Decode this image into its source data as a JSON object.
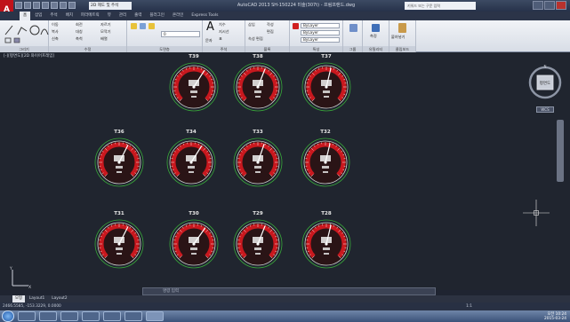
{
  "app": {
    "window_title": "AutoCAD 2013    SH-150224 미술(307t) - 프림프랜드.dwg",
    "workspace": "2D 제도 및 주석",
    "search_placeholder": "키워드 또는 구문 입력",
    "logo": "A"
  },
  "ribbon": {
    "tabs": [
      "홈",
      "삽입",
      "주석",
      "배치",
      "파라메트릭",
      "뷰",
      "관리",
      "출력",
      "플러그인",
      "온라인",
      "Express Tools"
    ],
    "active_tab": 0,
    "groups": {
      "draw": "그리기",
      "modify": "수정",
      "layers": "도면층",
      "annotation": "주석",
      "block": "블록",
      "properties": "특성",
      "groups": "그룹",
      "utilities": "유틸리티",
      "clipboard": "클립보드"
    },
    "draw_tools": [
      "선",
      "폴리선",
      "원",
      "호"
    ],
    "modify_tools": [
      "이동",
      "회전",
      "자르기",
      "복사",
      "대칭",
      "모깍기",
      "신축",
      "축척",
      "배열"
    ],
    "annotation_tools": [
      "문자",
      "치수",
      "지시선",
      "표"
    ],
    "block_tools": [
      "삽입",
      "작성",
      "편집",
      "속성 편집"
    ],
    "properties_values": [
      "ByLayer",
      "ByLayer",
      "ByLayer"
    ],
    "layer_value": "0",
    "group_label": "그룹",
    "paste_label": "붙여넣기",
    "measure_label": "측정",
    "text_label": "문자",
    "dimension_label": "치수",
    "insert_label": "삽입",
    "match_label": "특성 일치"
  },
  "viewport_label": "[-][평면도][2D 와이어프레임]",
  "gauges": [
    {
      "label": "T39",
      "needle": 0.62
    },
    {
      "label": "T38",
      "needle": 0.58
    },
    {
      "label": "T37",
      "needle": 0.55
    },
    {
      "label": "T36",
      "needle": 0.6
    },
    {
      "label": "T34",
      "needle": 0.62
    },
    {
      "label": "T33",
      "needle": 0.57
    },
    {
      "label": "T32",
      "needle": 0.55
    },
    {
      "label": "T31",
      "needle": 0.6
    },
    {
      "label": "T30",
      "needle": 0.63
    },
    {
      "label": "T29",
      "needle": 0.58
    },
    {
      "label": "T28",
      "needle": 0.55
    }
  ],
  "navigation": {
    "viewcube_face": "평면도",
    "wcs_label": "WCS"
  },
  "command": {
    "placeholder": "명령 입력"
  },
  "layout_tabs": [
    "모형",
    "Layout1",
    "Layout2"
  ],
  "active_layout": 0,
  "status": {
    "coords": "2466.5585, -153.3229, 0.0000",
    "scale": "모형",
    "right_text": "1:1"
  },
  "tray": {
    "time": "오전 10:24",
    "date": "2015-03-24"
  }
}
